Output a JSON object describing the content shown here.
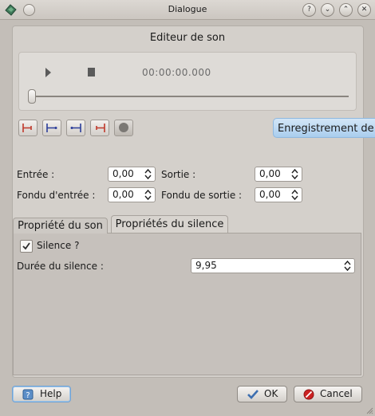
{
  "window": {
    "title": "Dialogue",
    "buttons": [
      "?",
      "⌄",
      "⌃",
      "✕"
    ]
  },
  "editor": {
    "title": "Editeur de son",
    "timecode": "00:00:00.000"
  },
  "tooltip": {
    "text": "Enregistrement de t"
  },
  "fields": {
    "entree_label": "Entrée :",
    "entree_value": "0,00",
    "sortie_label": "Sortie :",
    "sortie_value": "0,00",
    "fondu_entree_label": "Fondu d'entrée :",
    "fondu_entree_value": "0,00",
    "fondu_sortie_label": "Fondu de sortie :",
    "fondu_sortie_value": "0,00"
  },
  "tabs": [
    {
      "label": "Propriété du son",
      "active": false
    },
    {
      "label": "Propriétés du silence",
      "active": true
    }
  ],
  "silence": {
    "checkbox_label": "Silence ?",
    "checked": true,
    "duration_label": "Durée du silence :",
    "duration_value": "9,95"
  },
  "buttons": {
    "help": "Help",
    "ok": "OK",
    "cancel": "Cancel"
  },
  "colors": {
    "marker_red": "#c0392b",
    "marker_blue": "#2c3e9a",
    "tooltip_bg": "#b9d8f2"
  }
}
